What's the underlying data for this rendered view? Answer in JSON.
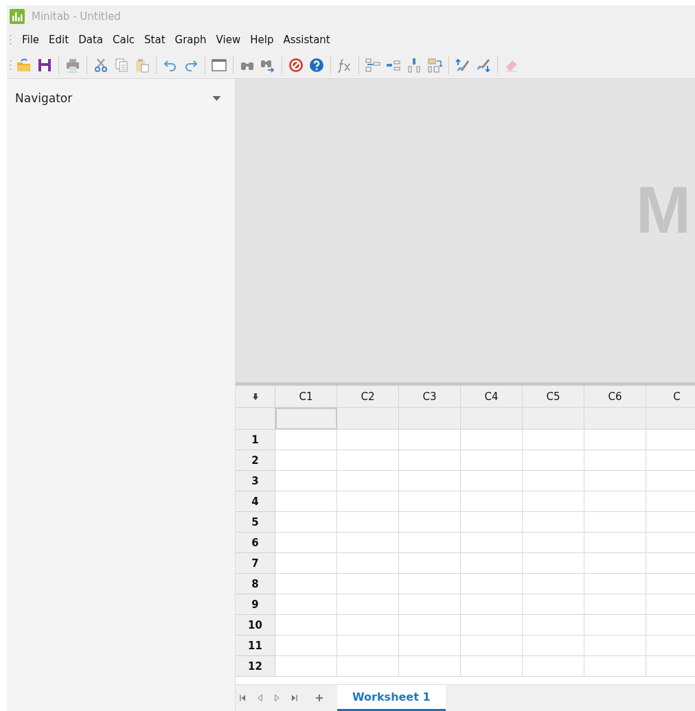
{
  "window": {
    "title": "Minitab - Untitled"
  },
  "menu": [
    "File",
    "Edit",
    "Data",
    "Calc",
    "Stat",
    "Graph",
    "View",
    "Help",
    "Assistant"
  ],
  "navigator": {
    "title": "Navigator"
  },
  "splash": {
    "letter": "M"
  },
  "worksheet": {
    "columns": [
      {
        "label": "C1",
        "name_cell_selected": true
      },
      {
        "label": "C2",
        "name_cell_selected": false
      },
      {
        "label": "C3",
        "name_cell_selected": false
      },
      {
        "label": "C4",
        "name_cell_selected": false
      },
      {
        "label": "C5",
        "name_cell_selected": false
      },
      {
        "label": "C6",
        "name_cell_selected": false
      },
      {
        "label": "C",
        "name_cell_selected": false
      }
    ],
    "rows": [
      "1",
      "2",
      "3",
      "4",
      "5",
      "6",
      "7",
      "8",
      "9",
      "10",
      "11",
      "12"
    ]
  },
  "tabs": [
    {
      "label": "Worksheet 1",
      "selected": true
    }
  ]
}
